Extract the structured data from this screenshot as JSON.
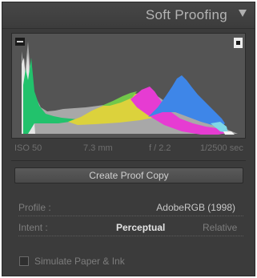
{
  "panel": {
    "title": "Soft Proofing",
    "collapse_icon": "triangle-down-icon"
  },
  "histogram": {
    "info": {
      "iso": "ISO 50",
      "focal_length": "7.3 mm",
      "aperture": "f / 2.2",
      "shutter": "1/2500 sec"
    },
    "colors": {
      "background": "#545454",
      "luminance": "#a8a8a8",
      "red": "#e8e8e8",
      "green": "#22c26c",
      "blue": "#3e86e8",
      "yellow": "#dcd23c",
      "magenta": "#e63cd2",
      "cyan": "#7fd7e6"
    }
  },
  "create_proof_copy_label": "Create Proof Copy",
  "profile": {
    "label": "Profile :",
    "value": "AdobeRGB (1998)"
  },
  "intent": {
    "label": "Intent :",
    "options": [
      "Perceptual",
      "Relative"
    ],
    "selected": "Perceptual"
  },
  "simulate_paper_ink": {
    "label": "Simulate Paper & Ink",
    "checked": false
  }
}
